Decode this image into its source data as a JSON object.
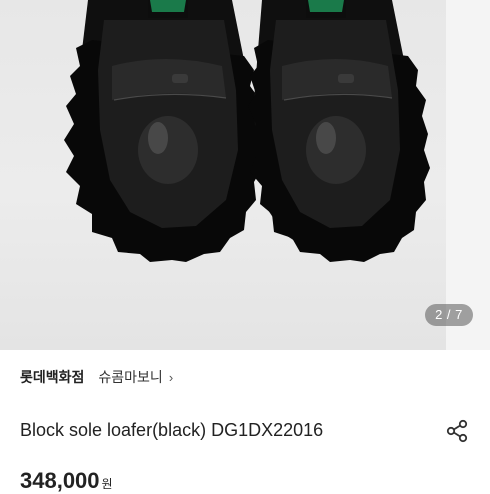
{
  "gallery": {
    "current_page": "2",
    "total_pages": "7",
    "indicator": "2 / 7"
  },
  "store": {
    "name": "롯데백화점",
    "brand": "슈콤마보니",
    "chevron": "›"
  },
  "product": {
    "title": "Block sole loafer(black) DG1DX22016",
    "price": "348,000",
    "currency": "원"
  },
  "icons": [
    "share-icon",
    "chevron-right-icon"
  ],
  "colors": {
    "background": "#ffffff",
    "text": "#222222",
    "indicator_bg": "#5a5a5a"
  }
}
